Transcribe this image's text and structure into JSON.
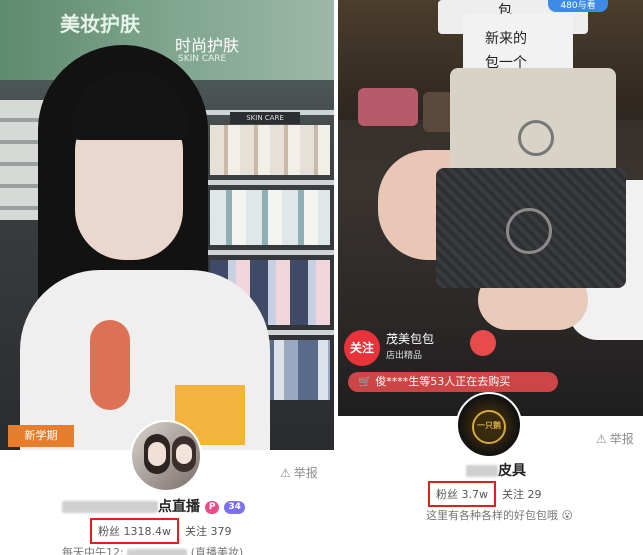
{
  "left": {
    "poster_text_1": "美妆护肤",
    "poster_text_2": "时尚护肤",
    "poster_text_3": "SKIN CARE",
    "shelf_label": "SKIN CARE",
    "corner_banner": "新学期",
    "report_label": "举报",
    "streamer_name_suffix": "点直播",
    "level_badge": "34",
    "fans_label": "粉丝 1318.4w",
    "follow_label": "关注 379",
    "description": "每天中午12:",
    "description_tail": "(直播美妆)"
  },
  "right": {
    "sign_top": "包",
    "sign_line_1": "新来的",
    "sign_line_2": "包一个",
    "top_badge": "480与看",
    "follow_button": "关注",
    "shop_name": "茂美包包",
    "shop_sub": "店出精品",
    "purchase_ticker": "俊****生等53人正在去购买",
    "report_label": "举报",
    "streamer_name_suffix": "皮具",
    "fans_label": "粉丝 3.7w",
    "follow_label": "关注 29",
    "description": "这里有各种各样的好包包哦",
    "avatar_text": "一只鹅"
  },
  "colors": {
    "highlight_red": "#e0201c",
    "level_purple": "#7c6ff0",
    "follow_red": "#e8333a"
  }
}
